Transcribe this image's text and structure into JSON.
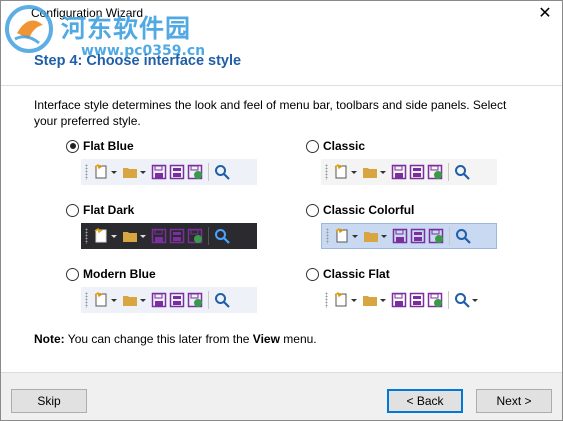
{
  "window": {
    "title": "Configuration Wizard",
    "close_glyph": "✕"
  },
  "watermark": {
    "text": "河东软件园",
    "url": "www.pc0359.cn"
  },
  "step_title": "Step 4: Choose interface style",
  "description": "Interface style determines the look and feel of menu bar, toolbars and side panels. Select your preferred style.",
  "options": [
    {
      "label": "Flat Blue",
      "checked": true
    },
    {
      "label": "Classic",
      "checked": false
    },
    {
      "label": "Flat Dark",
      "checked": false
    },
    {
      "label": "Classic Colorful",
      "checked": false
    },
    {
      "label": "Modern Blue",
      "checked": false
    },
    {
      "label": "Classic Flat",
      "checked": false
    }
  ],
  "note": {
    "prefix": "Note:",
    "text_before": " You can change this later from the ",
    "menu": "View",
    "text_after": " menu."
  },
  "buttons": {
    "skip": "Skip",
    "back": "< Back",
    "next": "Next >"
  },
  "icons": [
    "new-document-icon",
    "open-folder-icon",
    "save-icon",
    "save-all-icon",
    "save-to-web-icon",
    "search-icon"
  ],
  "colors": {
    "accent": "#1f5ea8",
    "icon_purple": "#7b2f9e",
    "folder": "#d8a640",
    "dark_toolbar": "#2b2b2f"
  }
}
